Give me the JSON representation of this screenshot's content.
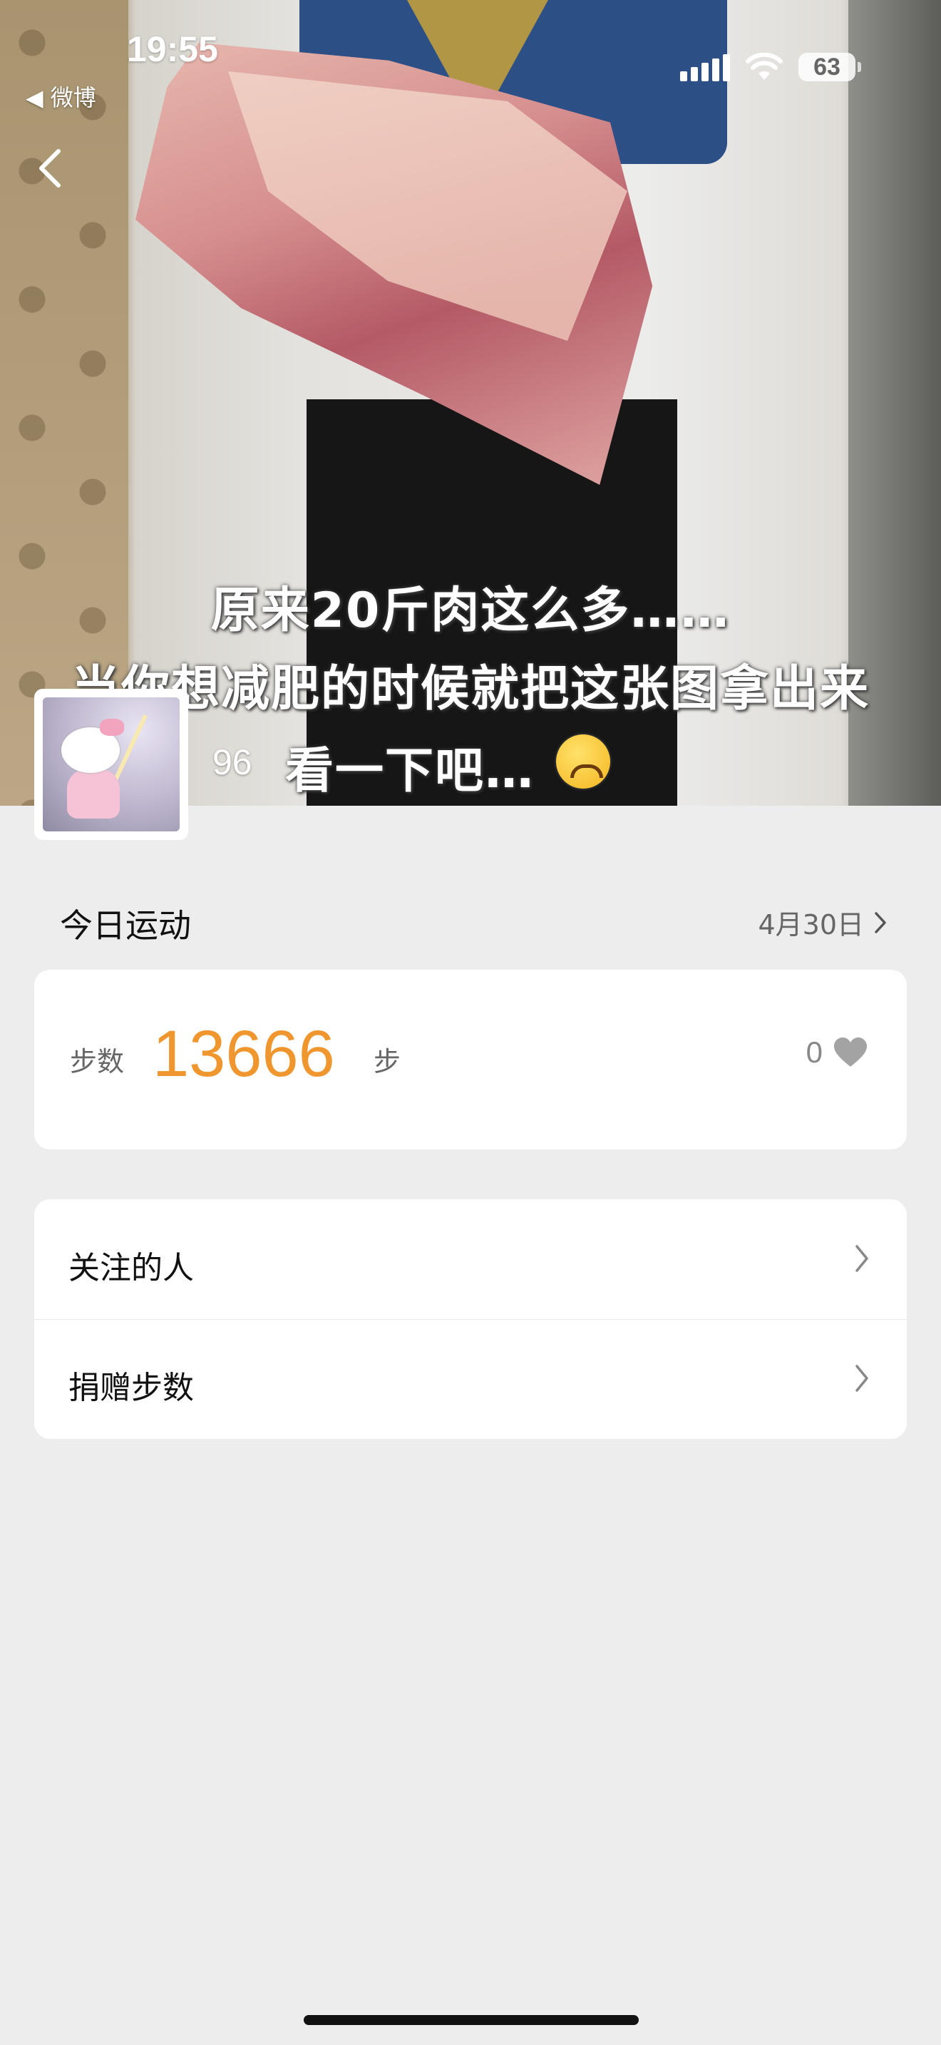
{
  "status_bar": {
    "time": "19:55",
    "back_app": "◀ 微博",
    "battery": "63",
    "icons": [
      "signal-icon",
      "wifi-icon",
      "battery-icon"
    ]
  },
  "cover": {
    "caption_lines": [
      "原来20斤肉这么多……",
      "当你想减肥的时候就把这张图拿出来",
      "看一下吧…"
    ],
    "emoji": "upside-down-face"
  },
  "profile": {
    "likes": "96"
  },
  "today": {
    "title": "今日运动",
    "date": "4月30日",
    "steps_label": "步数",
    "steps_value": "13666",
    "steps_unit": "步",
    "likes": "0"
  },
  "menu": {
    "items": [
      {
        "label": "关注的人"
      },
      {
        "label": "捐赠步数"
      }
    ]
  },
  "colors": {
    "accent": "#f0962e",
    "background": "#ededed",
    "card": "#ffffff"
  }
}
